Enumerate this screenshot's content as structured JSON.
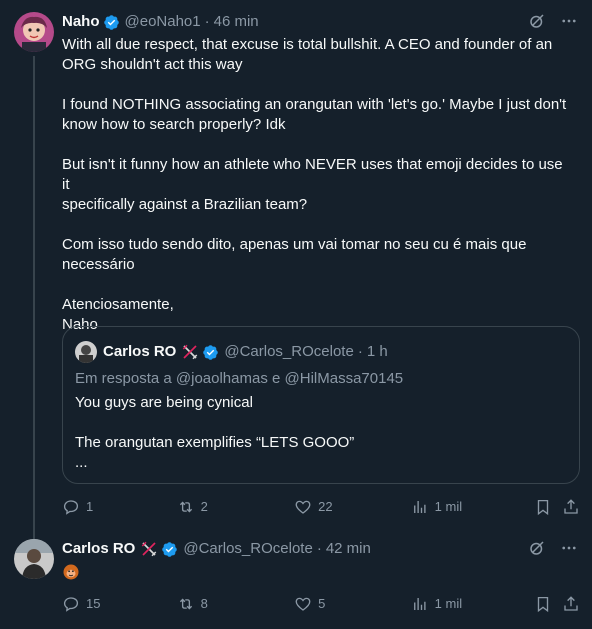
{
  "tweet1": {
    "name": "Naho",
    "handle": "@eoNaho1",
    "separator": "·",
    "time": "46 min",
    "lines": [
      "With all due respect, that excuse is total bullshit. A CEO and founder of an",
      "ORG shouldn't act this way",
      "",
      "I found NOTHING associating an orangutan with 'let's go.' Maybe I just don't",
      "know how to search properly? Idk",
      "",
      "But isn't it funny how an athlete who NEVER uses that emoji decides to use it",
      "specifically against a Brazilian team?",
      "",
      "Com isso tudo sendo dito, apenas um vai tomar no seu cu é mais que",
      "necessário",
      "",
      "Atenciosamente,",
      "Naho"
    ],
    "quote": {
      "name": "Carlos RO",
      "handle": "@Carlos_ROcelote",
      "separator": "·",
      "time": "1 h",
      "reply_prefix": "Em resposta a",
      "reply_to_1": "@joaolhamas",
      "reply_and": "e",
      "reply_to_2": "@HilMassa70145",
      "lines": [
        "You guys are being cynical",
        "",
        "The orangutan exemplifies “LETS GOOO”",
        "..."
      ]
    },
    "actions": {
      "replies": "1",
      "reposts": "2",
      "likes": "22",
      "views": "1 mil"
    }
  },
  "tweet2": {
    "name": "Carlos RO",
    "handle": "@Carlos_ROcelote",
    "separator": "·",
    "time": "42 min",
    "emoji": "orangutan",
    "actions": {
      "replies": "15",
      "reposts": "8",
      "likes": "5",
      "views": "1 mil"
    }
  },
  "colors": {
    "background": "#15202b",
    "text": "#f7f9f9",
    "muted": "#8b98a5",
    "verified": "#1d9bf0",
    "border": "#38444d"
  }
}
